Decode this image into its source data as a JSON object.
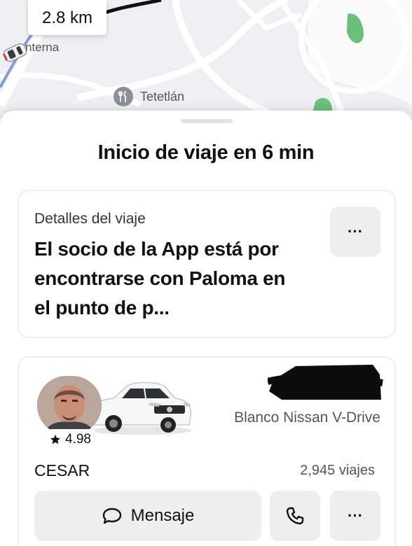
{
  "map": {
    "distance": "2.8 km",
    "street_label": "nterna",
    "poi_label": "Tetetlán",
    "poi_icon": "restaurant-icon",
    "route_color": "#111111",
    "park_color": "#6abf7b"
  },
  "sheet": {
    "title": "Inicio de viaje en 6 min"
  },
  "trip_details": {
    "label": "Detalles del viaje",
    "text": "El socio de la App está por encontrarse con Paloma en el punto de p...",
    "more_label": "···"
  },
  "driver": {
    "rating": "4.98",
    "rating_icon": "star-icon",
    "name": "CESAR",
    "car_description": "Blanco Nissan V-Drive",
    "trips": "2,945 viajes"
  },
  "actions": {
    "message_label": "Mensaje",
    "message_icon": "chat-bubble-icon",
    "call_icon": "phone-icon",
    "more_label": "···"
  }
}
